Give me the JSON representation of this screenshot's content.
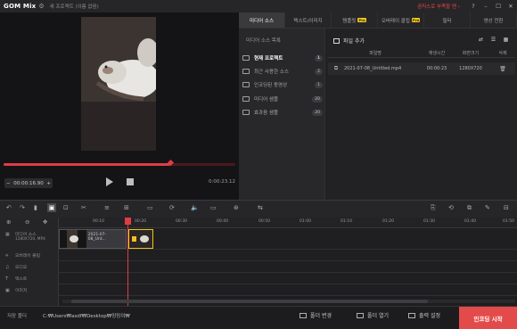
{
  "titlebar": {
    "logo": "GOM Mix",
    "project_name": "새 프로젝트 (이름 없음)",
    "upgrade_text": "곰믹스로 부족할 땐 ›",
    "icons": [
      "gear-icon",
      "help-icon",
      "minimize-icon",
      "maximize-icon",
      "close-icon"
    ]
  },
  "preview": {
    "current_time": "00:00:16.90",
    "duration": "0:00:23.12",
    "seek_progress": 0.72,
    "minus": "−",
    "plus": "+"
  },
  "tabs": [
    {
      "label": "미디어 소스",
      "active": true,
      "pro": false
    },
    {
      "label": "텍스트/이미지",
      "active": false,
      "pro": false
    },
    {
      "label": "템플릿",
      "active": false,
      "pro": true
    },
    {
      "label": "오버레이 클립",
      "active": false,
      "pro": true
    },
    {
      "label": "필터",
      "active": false,
      "pro": false
    },
    {
      "label": "영상 전환",
      "active": false,
      "pro": false
    }
  ],
  "pro_badge": "Pro",
  "sidebar": {
    "heading": "미디어 소스 목록",
    "items": [
      {
        "label": "현재 프로젝트",
        "count": "1",
        "active": true
      },
      {
        "label": "최근 사용한 소스",
        "count": "2",
        "active": false
      },
      {
        "label": "인코딩된 동영상",
        "count": "1",
        "active": false
      },
      {
        "label": "미디어 샘플",
        "count": "20",
        "active": false
      },
      {
        "label": "효과음 샘플",
        "count": "20",
        "active": false
      }
    ]
  },
  "media_list": {
    "add_file": "파일 추가",
    "columns": [
      "파일명",
      "재생시간",
      "화면크기",
      "삭제"
    ],
    "rows": [
      {
        "name": "2021-07-08_Untitled.mp4",
        "duration": "00:00:23",
        "size": "1280X720"
      }
    ]
  },
  "timeline": {
    "ticks": [
      "00:10",
      "00:20",
      "00:30",
      "00:40",
      "00:50",
      "01:00",
      "01:10",
      "01:20",
      "01:30",
      "01:40",
      "01:50"
    ],
    "tracks": [
      {
        "label": "미디어 소스",
        "sub": "1280X720, MP4",
        "icon": "film-icon"
      },
      {
        "label": "오버레이 클립",
        "icon": "overlay-icon"
      },
      {
        "label": "오디오",
        "icon": "music-icon"
      },
      {
        "label": "텍스트",
        "icon": "text-icon"
      },
      {
        "label": "이미지",
        "icon": "image-icon"
      }
    ],
    "clip_name": "2021-07-08_Unt..."
  },
  "bottom": {
    "save_label": "저장 폴더",
    "save_path": "C:₩Users₩asdf₩Desktop₩밍밍이₩",
    "change_folder": "폴더 변경",
    "open_folder": "폴더 열기",
    "output_settings": "출력 설정",
    "encode": "인코딩 시작"
  },
  "colors": {
    "accent": "#e34b4b",
    "pro": "#f0c419"
  }
}
